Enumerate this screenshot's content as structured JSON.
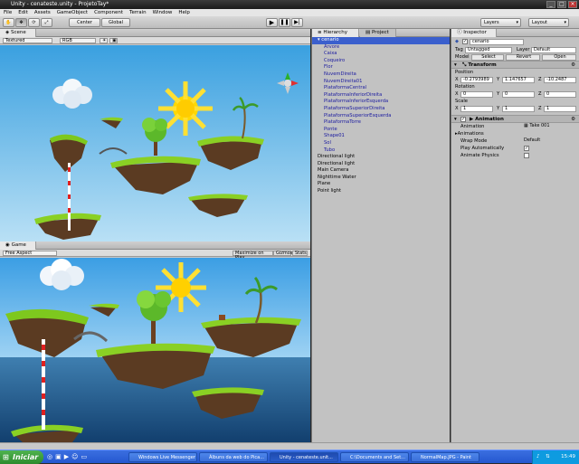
{
  "window": {
    "title": "Unity - cenateste.unity - ProjetoTay*"
  },
  "menu": [
    "File",
    "Edit",
    "Assets",
    "GameObject",
    "Component",
    "Terrain",
    "Window",
    "Help"
  ],
  "toolbar": {
    "center": "Center",
    "global": "Global",
    "layers": "Layers",
    "layout": "Layout"
  },
  "scene": {
    "tab": "Scene",
    "shading": "Textured",
    "render": "RGB"
  },
  "game": {
    "tab": "Game",
    "aspect": "Free Aspect",
    "maximize": "Maximize on Play",
    "gizmos": "Gizmos",
    "stats": "Stats"
  },
  "hierarchy": {
    "tab": "Hierarchy",
    "project_tab": "Project",
    "selected": "cenario",
    "children": [
      "Arvore",
      "Caixa",
      "Coqueiro",
      "Flor",
      "NuvemDireita",
      "NuvemDireita01",
      "PlataformaCentral",
      "PlataformaInferiorDireita",
      "PlataformaInferiorEsquerda",
      "PlataformaSuperiorDireita",
      "PlataformaSuperiorEsquerda",
      "PlataformaTorre",
      "Ponte",
      "Shape01",
      "Sol",
      "Tubo"
    ],
    "roots": [
      "Directional light",
      "Directional light",
      "Main Camera",
      "Nighttime Water",
      "Plane",
      "Point light"
    ]
  },
  "inspector": {
    "tab": "Inspector",
    "object_name": "cenario",
    "tag_label": "Tag",
    "tag_value": "Untagged",
    "layer_label": "Layer",
    "layer_value": "Default",
    "model_label": "Model",
    "model_buttons": [
      "Select",
      "Revert",
      "Open"
    ],
    "transform": {
      "title": "Transform",
      "position_label": "Position",
      "position": {
        "x": "-0.2793989",
        "y": "1.147657",
        "z": "-10.2487"
      },
      "rotation_label": "Rotation",
      "rotation": {
        "x": "0",
        "y": "0",
        "z": "0"
      },
      "scale_label": "Scale",
      "scale": {
        "x": "1",
        "y": "1",
        "z": "1"
      }
    },
    "animation": {
      "title": "Animation",
      "animation_label": "Animation",
      "animation_value": "Take 001",
      "animations_label": "Animations",
      "wrap_label": "Wrap Mode",
      "wrap_value": "Default",
      "play_auto_label": "Play Automatically",
      "play_auto": true,
      "physics_label": "Animate Physics",
      "physics": false
    }
  },
  "taskbar": {
    "start": "Iniciar",
    "tasks": [
      "Windows Live Messenger",
      "Álbuns da web do Pica...",
      "Unity - cenateste.unit...",
      "C:\\Documents and Set...",
      "NormalMap.JPG - Paint"
    ],
    "active_task": 2,
    "clock": "15:49"
  },
  "colors": {
    "sky_top": "#3aa0e0",
    "sky_bottom": "#b9e0f5",
    "water": "#1e5f9a",
    "grass": "#7ec81e",
    "selection": "#3a5fcd"
  }
}
